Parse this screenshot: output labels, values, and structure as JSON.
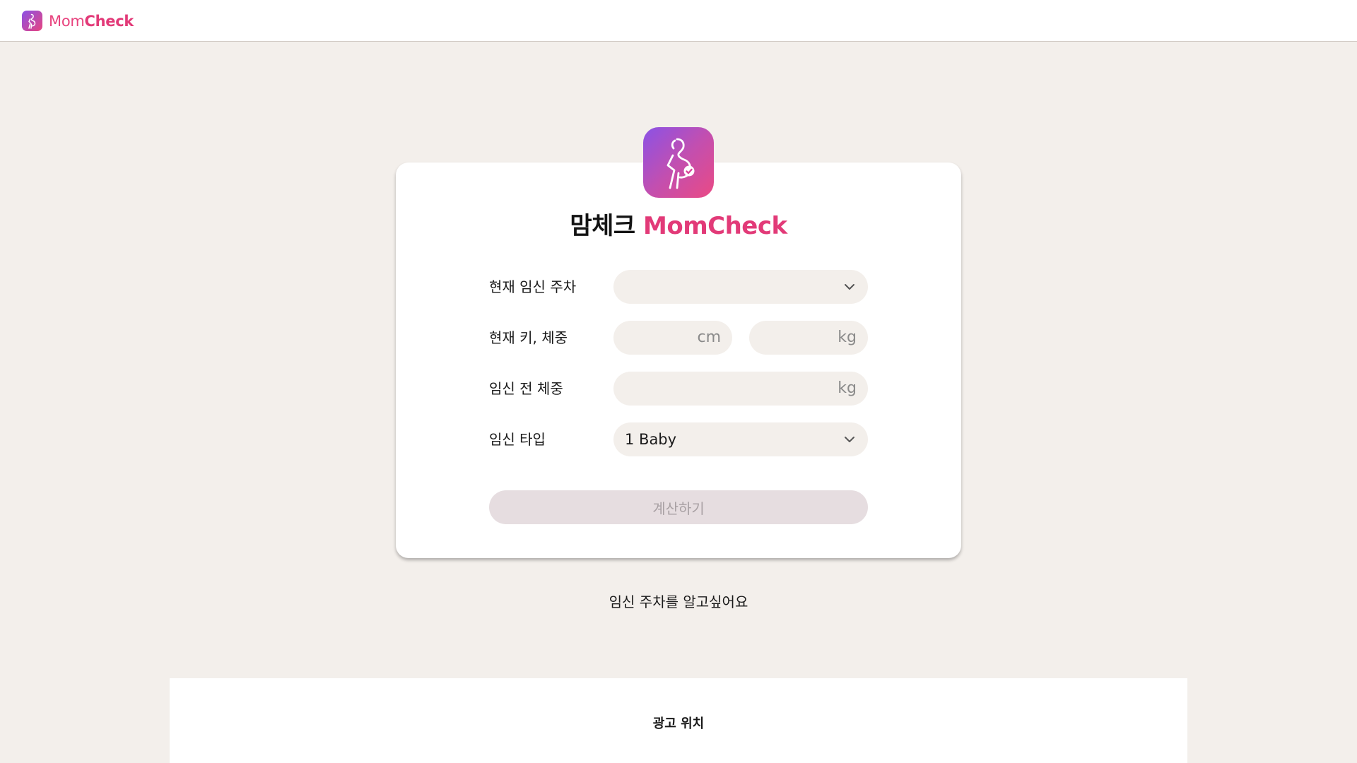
{
  "header": {
    "brand_mom": "Mom",
    "brand_check": "Check"
  },
  "card": {
    "title_ko": "맘체크",
    "title_en": "MomCheck",
    "fields": {
      "week_label": "현재 임신 주차",
      "week_value": "",
      "height_weight_label": "현재 키, 체중",
      "height_unit": "cm",
      "weight_unit": "kg",
      "pre_weight_label": "임신 전 체중",
      "pre_weight_unit": "kg",
      "type_label": "임신 타입",
      "type_value": "1 Baby"
    },
    "calculate_button": "계산하기"
  },
  "week_link": "임신 주차를 알고싶어요",
  "ad": {
    "label": "광고 위치"
  },
  "colors": {
    "accent": "#e23a78",
    "gradient_start": "#8a52e6",
    "gradient_end": "#ea4a84",
    "background": "#f3efeb"
  },
  "icons": {
    "logo": "pregnant-woman-check-icon",
    "dropdown": "chevron-down-icon"
  }
}
